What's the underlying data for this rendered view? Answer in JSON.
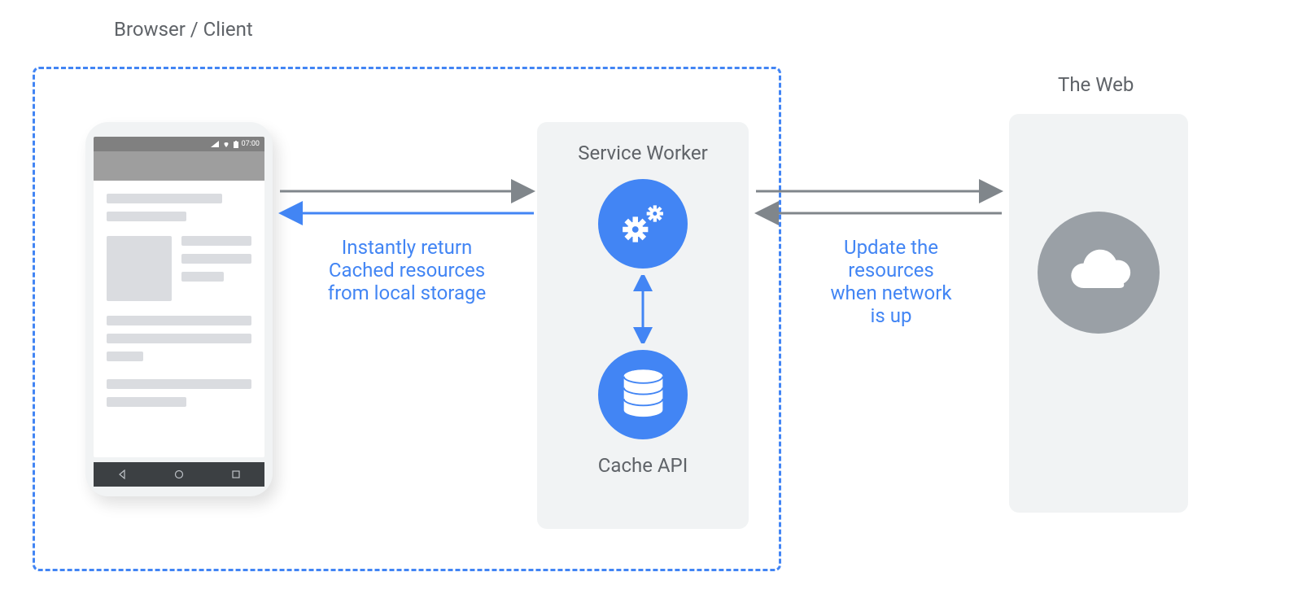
{
  "diagram": {
    "browser_client_label": "Browser / Client",
    "the_web_label": "The Web",
    "service_worker_label": "Service Worker",
    "cache_api_label": "Cache API",
    "phone_time": "07:00",
    "cache_caption": {
      "line1": "Instantly return",
      "line2": "Cached resources",
      "line3": "from local storage"
    },
    "network_caption": {
      "line1": "Update the",
      "line2": "resources",
      "line3": "when network",
      "line4": "is up"
    },
    "colors": {
      "blue": "#4285f4",
      "grey": "#9aa0a6",
      "text_grey": "#5f6368",
      "panel_bg": "#f1f3f4"
    },
    "icons": {
      "gears": "gears-icon",
      "database": "database-icon",
      "cloud": "cloud-icon"
    }
  }
}
